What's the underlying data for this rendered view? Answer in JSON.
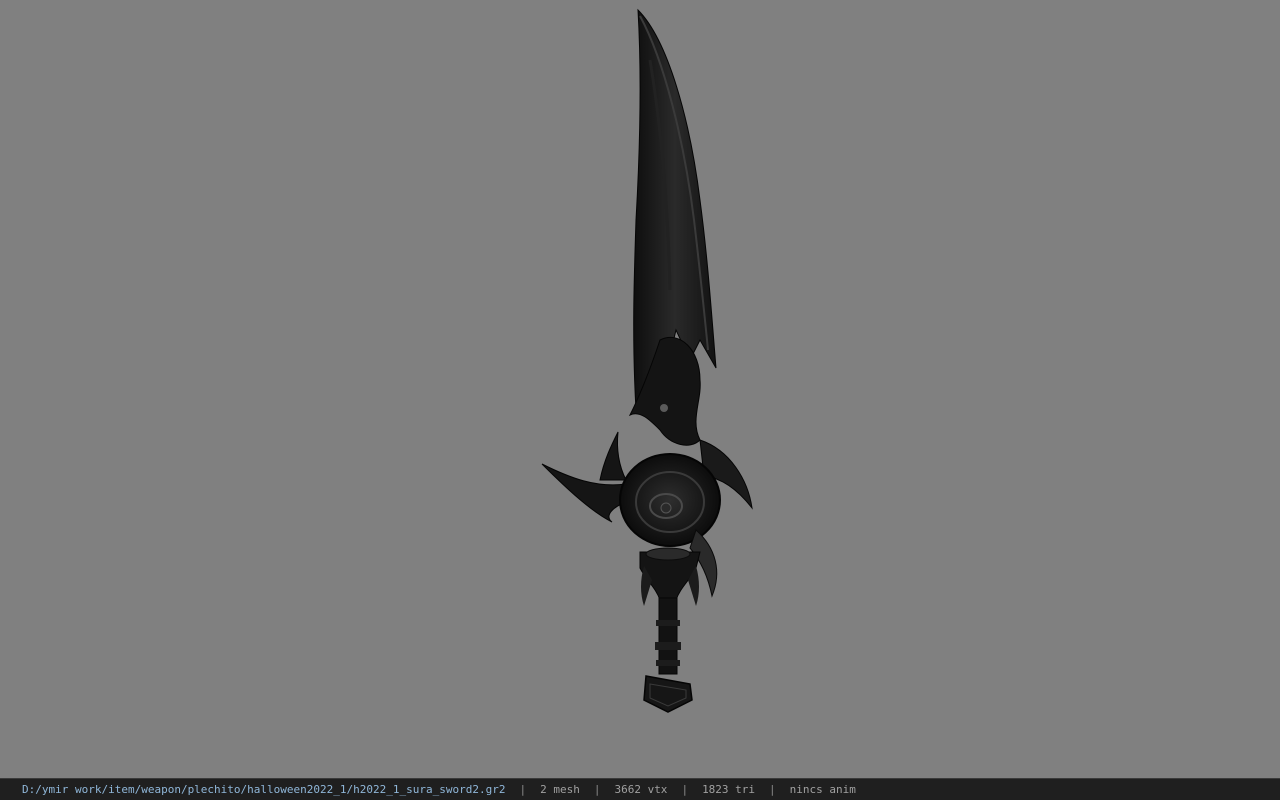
{
  "viewer": {
    "background_color": "#808080",
    "model_icon": "sword-model",
    "model_color": "#1a1a1a"
  },
  "status_bar": {
    "file_path": "D:/ymir work/item/weapon/plechito/halloween2022_1/h2022_1_sura_sword2.gr2",
    "separator": "|",
    "mesh_count": "2 mesh",
    "vertex_count": "3662 vtx",
    "triangle_count": "1823 tri",
    "animation": "nincs anim"
  }
}
